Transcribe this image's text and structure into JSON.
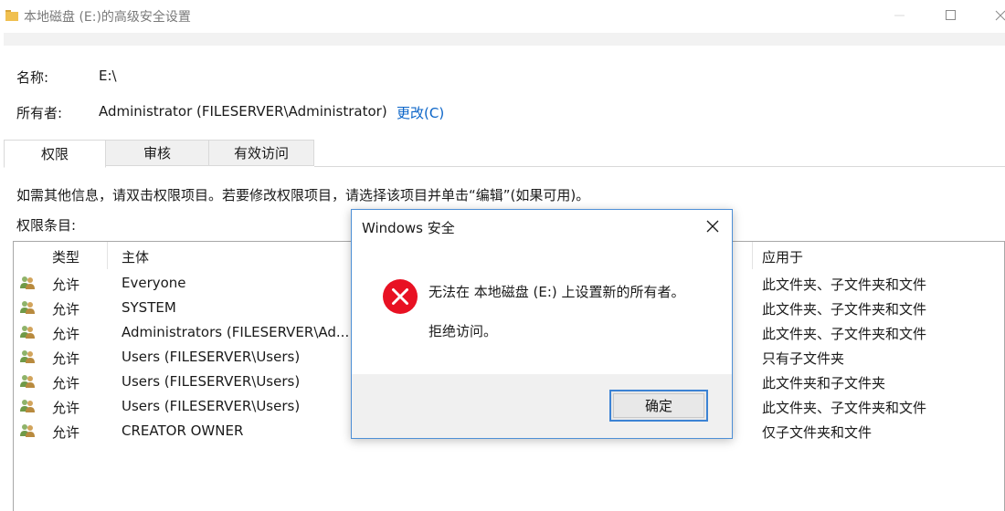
{
  "window": {
    "title": "本地磁盘 (E:)的高级安全设置",
    "accent_folder_color": "#e8b84a"
  },
  "object": {
    "name_label": "名称:",
    "name_value": "E:\\",
    "owner_label": "所有者:",
    "owner_value": "Administrator (FILESERVER\\Administrator)",
    "change_link": "更改(C)"
  },
  "tabs": [
    {
      "label": "权限",
      "active": true
    },
    {
      "label": "审核",
      "active": false
    },
    {
      "label": "有效访问",
      "active": false
    }
  ],
  "info_text": "如需其他信息，请双击权限项目。若要修改权限项目，请选择该项目并单击“编辑”(如果可用)。",
  "entries_label": "权限条目:",
  "table": {
    "columns": {
      "type": "类型",
      "principal": "主体",
      "applies_to": "应用于"
    },
    "rows": [
      {
        "type": "允许",
        "principal": "Everyone",
        "applies_to": "此文件夹、子文件夹和文件"
      },
      {
        "type": "允许",
        "principal": "SYSTEM",
        "applies_to": "此文件夹、子文件夹和文件"
      },
      {
        "type": "允许",
        "principal": "Administrators (FILESERVER\\Ad...",
        "applies_to": "此文件夹、子文件夹和文件"
      },
      {
        "type": "允许",
        "principal": "Users (FILESERVER\\Users)",
        "applies_to": "只有子文件夹"
      },
      {
        "type": "允许",
        "principal": "Users (FILESERVER\\Users)",
        "applies_to": "此文件夹和子文件夹"
      },
      {
        "type": "允许",
        "principal": "Users (FILESERVER\\Users)",
        "applies_to": "此文件夹、子文件夹和文件"
      },
      {
        "type": "允许",
        "principal": "CREATOR OWNER",
        "applies_to": "仅子文件夹和文件"
      }
    ]
  },
  "dialog": {
    "title": "Windows 安全",
    "message": "无法在 本地磁盘 (E:) 上设置新的所有者。",
    "sub_message": "拒绝访问。",
    "ok_label": "确定",
    "icon": "error-icon",
    "error_color": "#e81123"
  }
}
